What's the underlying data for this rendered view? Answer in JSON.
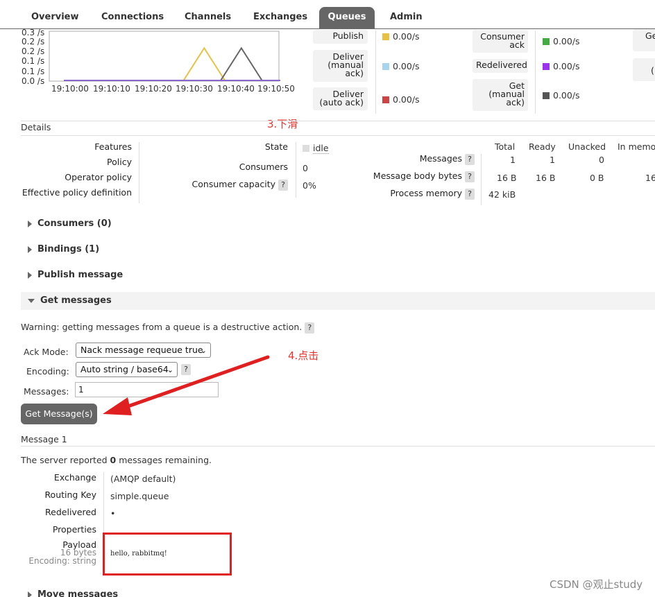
{
  "tabs": [
    {
      "label": "Overview"
    },
    {
      "label": "Connections"
    },
    {
      "label": "Channels"
    },
    {
      "label": "Exchanges"
    },
    {
      "label": "Queues"
    },
    {
      "label": "Admin"
    }
  ],
  "chart": {
    "y_ticks": [
      "0.3 /s",
      "0.2 /s",
      "0.2 /s",
      "0.1 /s",
      "0.1 /s",
      "0.0 /s"
    ],
    "x_ticks": [
      "19:10:00",
      "19:10:10",
      "19:10:20",
      "19:10:30",
      "19:10:40",
      "19:10:50"
    ]
  },
  "chart_data": {
    "type": "line",
    "x": [
      "19:10:00",
      "19:10:10",
      "19:10:20",
      "19:10:30",
      "19:10:40",
      "19:10:50"
    ],
    "ylim": [
      0,
      0.3
    ],
    "series": [
      {
        "color": "#e8c142",
        "points": [
          [
            "19:10:29",
            0.0
          ],
          [
            "19:10:34",
            0.2
          ],
          [
            "19:10:39",
            0.0
          ]
        ]
      },
      {
        "color": "#666666",
        "points": [
          [
            "19:10:38",
            0.0
          ],
          [
            "19:10:43",
            0.2
          ],
          [
            "19:10:48",
            0.0
          ]
        ]
      },
      {
        "color": "#8866cc",
        "points": [
          [
            "19:10:00",
            0.0
          ],
          [
            "19:10:54",
            0.0
          ]
        ]
      }
    ]
  },
  "rates": {
    "publish": {
      "label": "Publish",
      "value": "0.00/s",
      "color": "#e8c142"
    },
    "deliver_manual": {
      "label": "Deliver\n(manual\nack)",
      "value": "0.00/s",
      "color": "#a8d4f0"
    },
    "deliver_auto": {
      "label": "Deliver\n(auto ack)",
      "value": "0.00/s",
      "color": "#cc4444"
    },
    "consumer_ack": {
      "label": "Consumer\nack",
      "value": "0.00/s",
      "color": "#44aa44"
    },
    "redelivered": {
      "label": "Redelivered",
      "value": "0.00/s",
      "color": "#9933ee"
    },
    "get_manual": {
      "label": "Get\n(manual\nack)",
      "value": "0.00/s",
      "color": "#555555"
    },
    "cut1": "Ge",
    "cut2": "("
  },
  "annotations": {
    "step3": "3.下滑",
    "step4": "4.点击"
  },
  "details": {
    "heading": "Details",
    "features_label": "Features",
    "policy_label": "Policy",
    "operator_policy_label": "Operator policy",
    "effective_policy_label": "Effective policy definition",
    "state_label": "State",
    "state_value": "idle",
    "consumers_label": "Consumers",
    "consumers_value": "0",
    "capacity_label": "Consumer capacity",
    "capacity_value": "0%",
    "help": "?",
    "cols": {
      "total": "Total",
      "ready": "Ready",
      "unacked": "Unacked",
      "in_memory": "In memo"
    },
    "messages": {
      "label": "Messages",
      "total": "1",
      "ready": "1",
      "unacked": "0"
    },
    "body_bytes": {
      "label": "Message body bytes",
      "total": "16 B",
      "ready": "16 B",
      "unacked": "0 B",
      "in_memory": "16"
    },
    "process_memory": {
      "label": "Process memory",
      "total": "42 kiB"
    }
  },
  "sections": {
    "consumers": "Consumers (0)",
    "bindings": "Bindings (1)",
    "publish": "Publish message",
    "get": "Get messages",
    "move": "Move messages"
  },
  "get_messages": {
    "warning": "Warning: getting messages from a queue is a destructive action.",
    "ack_mode_label": "Ack Mode:",
    "ack_mode_value": "Nack message requeue true",
    "encoding_label": "Encoding:",
    "encoding_value": "Auto string / base64",
    "messages_label": "Messages:",
    "messages_value": "1",
    "button": "Get Message(s)"
  },
  "message": {
    "heading": "Message 1",
    "remaining_prefix": "The server reported ",
    "remaining_count": "0",
    "remaining_suffix": " messages remaining.",
    "exchange_label": "Exchange",
    "exchange_value": "(AMQP default)",
    "routing_key_label": "Routing Key",
    "routing_key_value": "simple.queue",
    "redelivered_label": "Redelivered",
    "redelivered_value": "•",
    "properties_label": "Properties",
    "payload_label": "Payload",
    "payload_size": "16 bytes",
    "payload_encoding": "Encoding: string",
    "payload_value": "hello, rabbitmq!"
  },
  "watermark": "CSDN @观止study"
}
